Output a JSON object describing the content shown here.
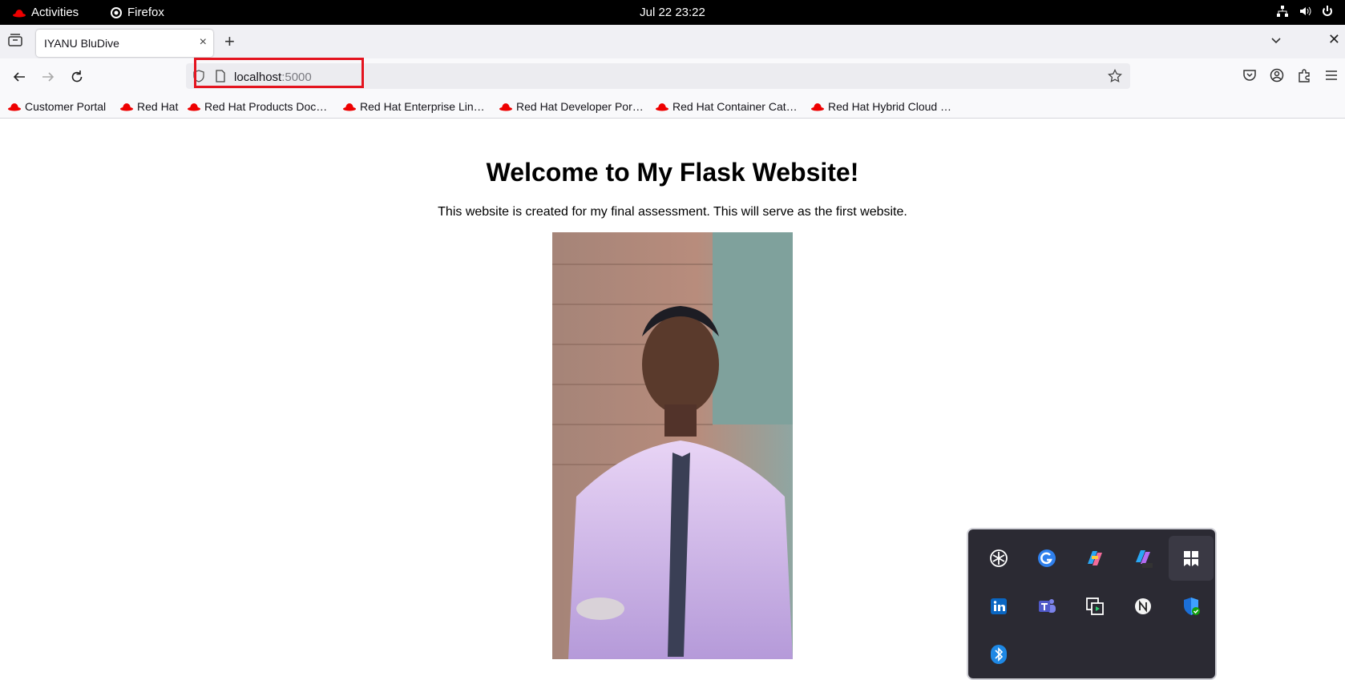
{
  "topbar": {
    "activities": "Activities",
    "app": "Firefox",
    "clock": "Jul 22  23:22"
  },
  "tab": {
    "title": "IYANU BluDive",
    "close": "×",
    "new": "+"
  },
  "window": {
    "close": "✕"
  },
  "url": {
    "host": "localhost",
    "port": ":5000"
  },
  "bookmarks": [
    "Customer Portal",
    "Red Hat",
    "Red Hat Products Doc…",
    "Red Hat Enterprise Lin…",
    "Red Hat Developer Por…",
    "Red Hat Container Cat…",
    "Red Hat Hybrid Cloud …"
  ],
  "page": {
    "heading": "Welcome to My Flask Website!",
    "text": "This website is created for my final assessment. This will serve as the first website."
  },
  "extensions_popup": {
    "icons": [
      "chatgpt-icon",
      "grammarly-icon",
      "copilot-icon",
      "copilot-m365-icon",
      "bookmark-app-icon",
      "linkedin-icon",
      "teams-icon",
      "screen-share-icon",
      "notion-icon",
      "defender-shield-icon",
      "bluetooth-icon"
    ]
  },
  "colors": {
    "highlight": "#e4141f",
    "redhat": "#ee0000"
  }
}
